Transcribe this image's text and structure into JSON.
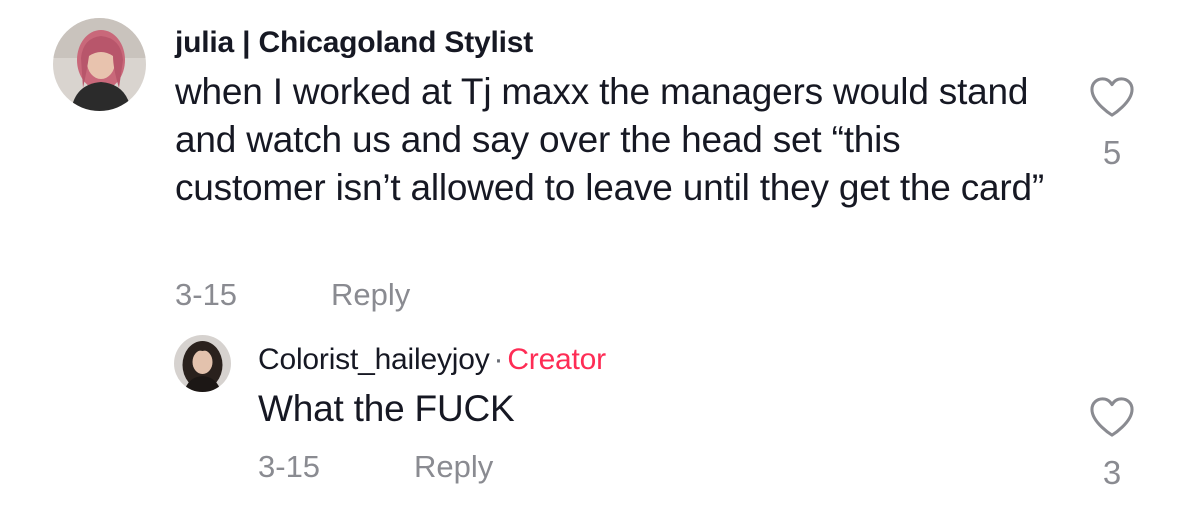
{
  "comments": [
    {
      "username": "julia | Chicagoland Stylist",
      "text": "when I worked at Tj maxx the managers would stand and watch us and say over the head set “this customer isn’t allowed to leave until they get the card”",
      "date": "3-15",
      "reply_label": "Reply",
      "like_count": "5"
    }
  ],
  "replies": [
    {
      "username": "Colorist_haileyjoy",
      "separator": "·",
      "badge": "Creator",
      "text": "What the FUCK",
      "date": "3-15",
      "reply_label": "Reply",
      "like_count": "3"
    }
  ],
  "colors": {
    "text_primary": "#161823",
    "text_secondary": "#8a8b91",
    "creator_accent": "#fe2c55"
  },
  "icons": {
    "like": "heart-outline-icon"
  }
}
